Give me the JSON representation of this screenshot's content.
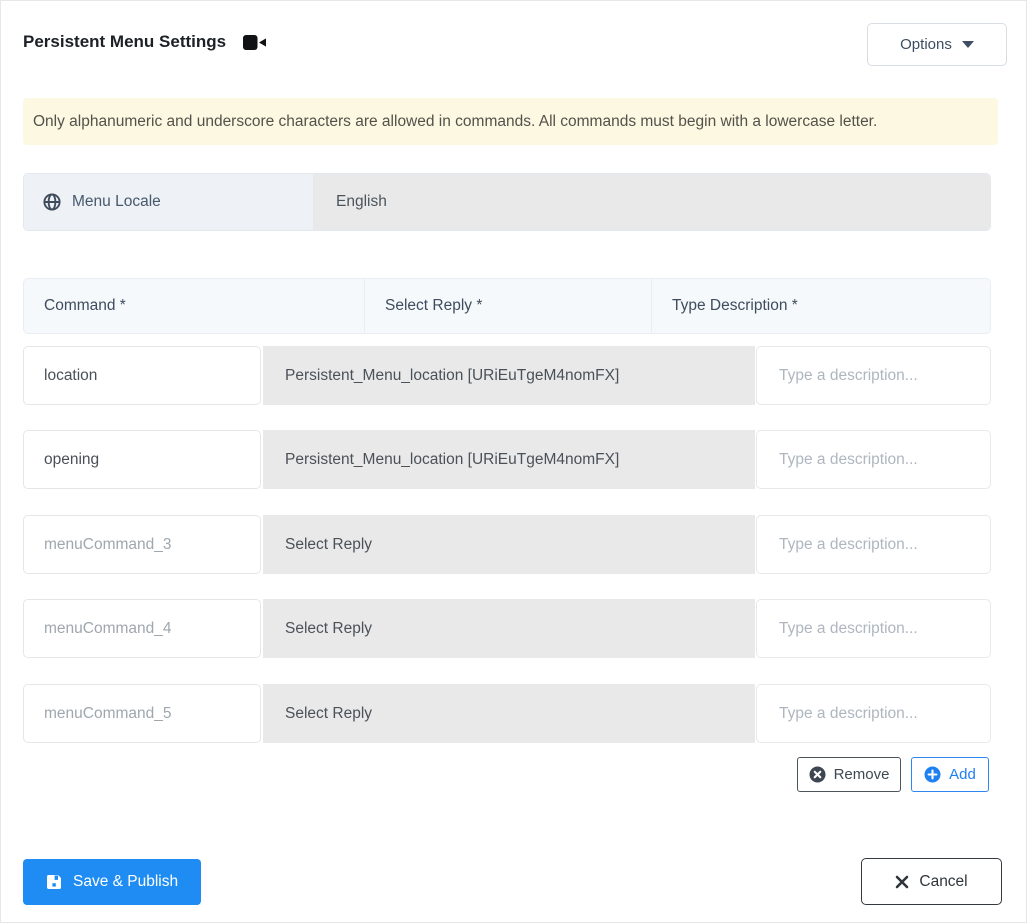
{
  "header": {
    "title": "Persistent Menu Settings",
    "title_icon": "video-camera-icon",
    "options_button": {
      "label": "Options",
      "icon": "caret-down-icon"
    }
  },
  "alert": {
    "text": "Only alphanumeric and underscore characters are allowed in commands. All commands must begin with a lowercase letter."
  },
  "menu_locale": {
    "icon": "globe-icon",
    "label": "Menu Locale",
    "value": "English"
  },
  "commands_table": {
    "headers": {
      "command": "Command *",
      "reply": "Select Reply *",
      "description": "Type Description *"
    },
    "description_placeholder": "Type a description...",
    "rows": [
      {
        "command": "location",
        "command_state": "filled",
        "reply": "Persistent_Menu_location [URiEuTgeM4nomFX]",
        "reply_state": "selected",
        "description": ""
      },
      {
        "command": "opening",
        "command_state": "filled",
        "reply": "Persistent_Menu_location [URiEuTgeM4nomFX]",
        "reply_state": "selected",
        "description": ""
      },
      {
        "command": "menuCommand_3",
        "command_state": "default",
        "reply": "Select Reply",
        "reply_state": "empty",
        "description": ""
      },
      {
        "command": "menuCommand_4",
        "command_state": "default",
        "reply": "Select Reply",
        "reply_state": "empty",
        "description": ""
      },
      {
        "command": "menuCommand_5",
        "command_state": "default",
        "reply": "Select Reply",
        "reply_state": "empty",
        "description": ""
      }
    ],
    "row_actions": {
      "remove": {
        "label": "Remove",
        "icon": "x-circle-icon"
      },
      "add": {
        "label": "Add",
        "icon": "plus-circle-icon"
      }
    }
  },
  "footer": {
    "save_button": {
      "label": "Save & Publish",
      "icon": "save-icon"
    },
    "cancel_button": {
      "label": "Cancel",
      "icon": "x-icon"
    }
  },
  "colors": {
    "primary_blue": "#1e8cf2",
    "add_blue": "#1f80f2",
    "alert_bg": "#fcf8e2",
    "disabled_bg": "#e9e9e9",
    "header_bg": "#f6f9fc",
    "dark_text": "#3f4c5d",
    "muted_text": "#9fa7ae"
  }
}
